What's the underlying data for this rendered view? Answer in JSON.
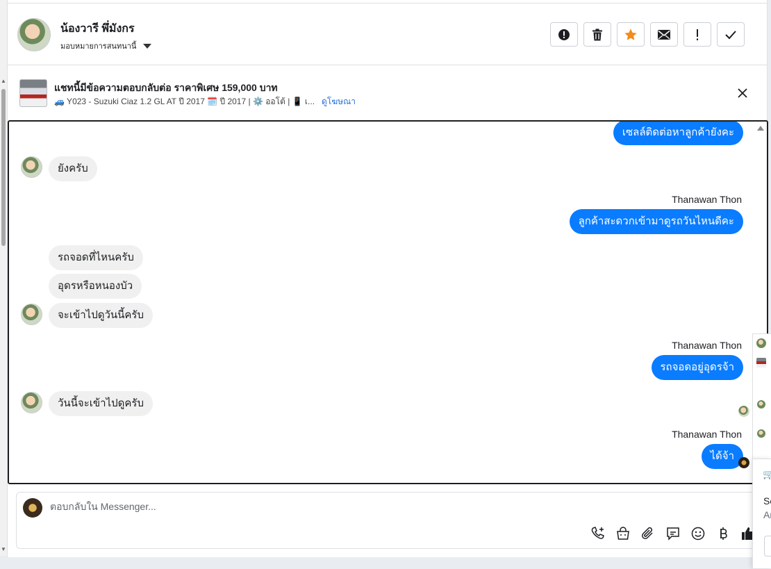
{
  "header": {
    "contact_name": "น้องวารี พึ่มังกร",
    "assign_label": "มอบหมายการสนทนานี้"
  },
  "actions": [
    "spam-report",
    "delete",
    "star",
    "mark-unread",
    "important",
    "mark-done"
  ],
  "ad": {
    "title": "แชทนี้มีข้อความตอบกลับต่อ ราคาพิเศษ 159,000 บาท",
    "subtitle": "🚙 Y023 - Suzuki Ciaz 1.2 GL AT ปี 2017 🗓️ ปี 2017 | ⚙️ ออโต้ | 📱 เ...",
    "link": "ดูโฆษณา"
  },
  "messages": {
    "m1": "เซลล์ติดต่อหาลูกค้ายังคะ",
    "m2": "ยังครับ",
    "sender1": "Thanawan Thon",
    "m3": "ลูกค้าสะดวกเข้ามาดูรถวันไหนดีคะ",
    "m4": "รถจอดที่ไหนครับ",
    "m5": "อุดรหรือหนองบัว",
    "m6": "จะเข้าไปดูวันนี้ครับ",
    "sender2": "Thanawan Thon",
    "m7": "รถจอดอยู่อุดรจ้า",
    "m8": "วันนี้จะเข้าไปดูครับ",
    "sender3": "Thanawan Thon",
    "m9": "ได้จ้า"
  },
  "composer": {
    "placeholder": "ตอบกลับใน Messenger..."
  },
  "side": {
    "line1": "Sc",
    "line2": "Ar"
  },
  "colors": {
    "outgoing_bubble": "#0a7cff",
    "incoming_bubble": "#f0f0f0",
    "star": "#f28a1c",
    "link": "#216fdb"
  }
}
